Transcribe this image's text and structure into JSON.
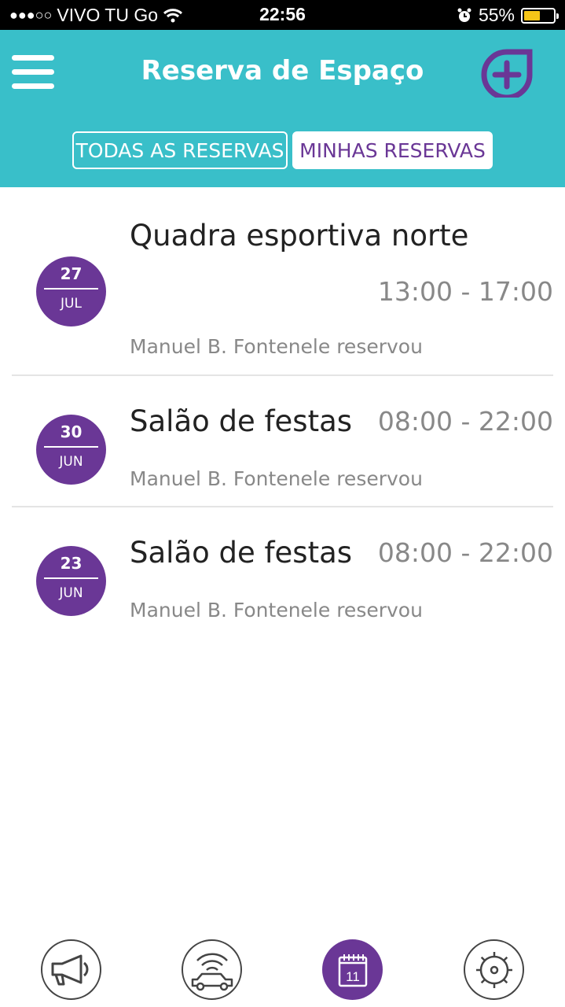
{
  "status_bar": {
    "signal": "●●●○○",
    "carrier": "VIVO TU Go",
    "time": "22:56",
    "battery": "55%",
    "battery_level": 0.55,
    "battery_color": "#f5c518"
  },
  "header": {
    "title": "Reserva de Espaço",
    "menu_icon": "hamburger-menu-icon",
    "add_icon": "add-circle-icon",
    "tabs": [
      {
        "label": "TODAS AS RESERVAS",
        "active": false
      },
      {
        "label": "MINHAS RESERVAS",
        "active": true
      }
    ]
  },
  "colors": {
    "header_bg": "#39bfc9",
    "accent": "#6a3796"
  },
  "reservations": [
    {
      "day": "27",
      "month": "JUL",
      "space": "Quadra esportiva norte",
      "time": "13:00 - 17:00",
      "reserved_by": "Manuel B. Fontenele reservou"
    },
    {
      "day": "30",
      "month": "JUN",
      "space": "Salão de festas",
      "time": "08:00 - 22:00",
      "reserved_by": "Manuel B. Fontenele reservou"
    },
    {
      "day": "23",
      "month": "JUN",
      "space": "Salão de festas",
      "time": "08:00 - 22:00",
      "reserved_by": "Manuel B. Fontenele reservou"
    }
  ],
  "tabbar": {
    "items": [
      {
        "icon": "megaphone-icon",
        "active": false
      },
      {
        "icon": "car-remote-icon",
        "active": false
      },
      {
        "icon": "calendar-icon",
        "label": "11",
        "active": true
      },
      {
        "icon": "gear-icon",
        "active": false
      }
    ]
  }
}
